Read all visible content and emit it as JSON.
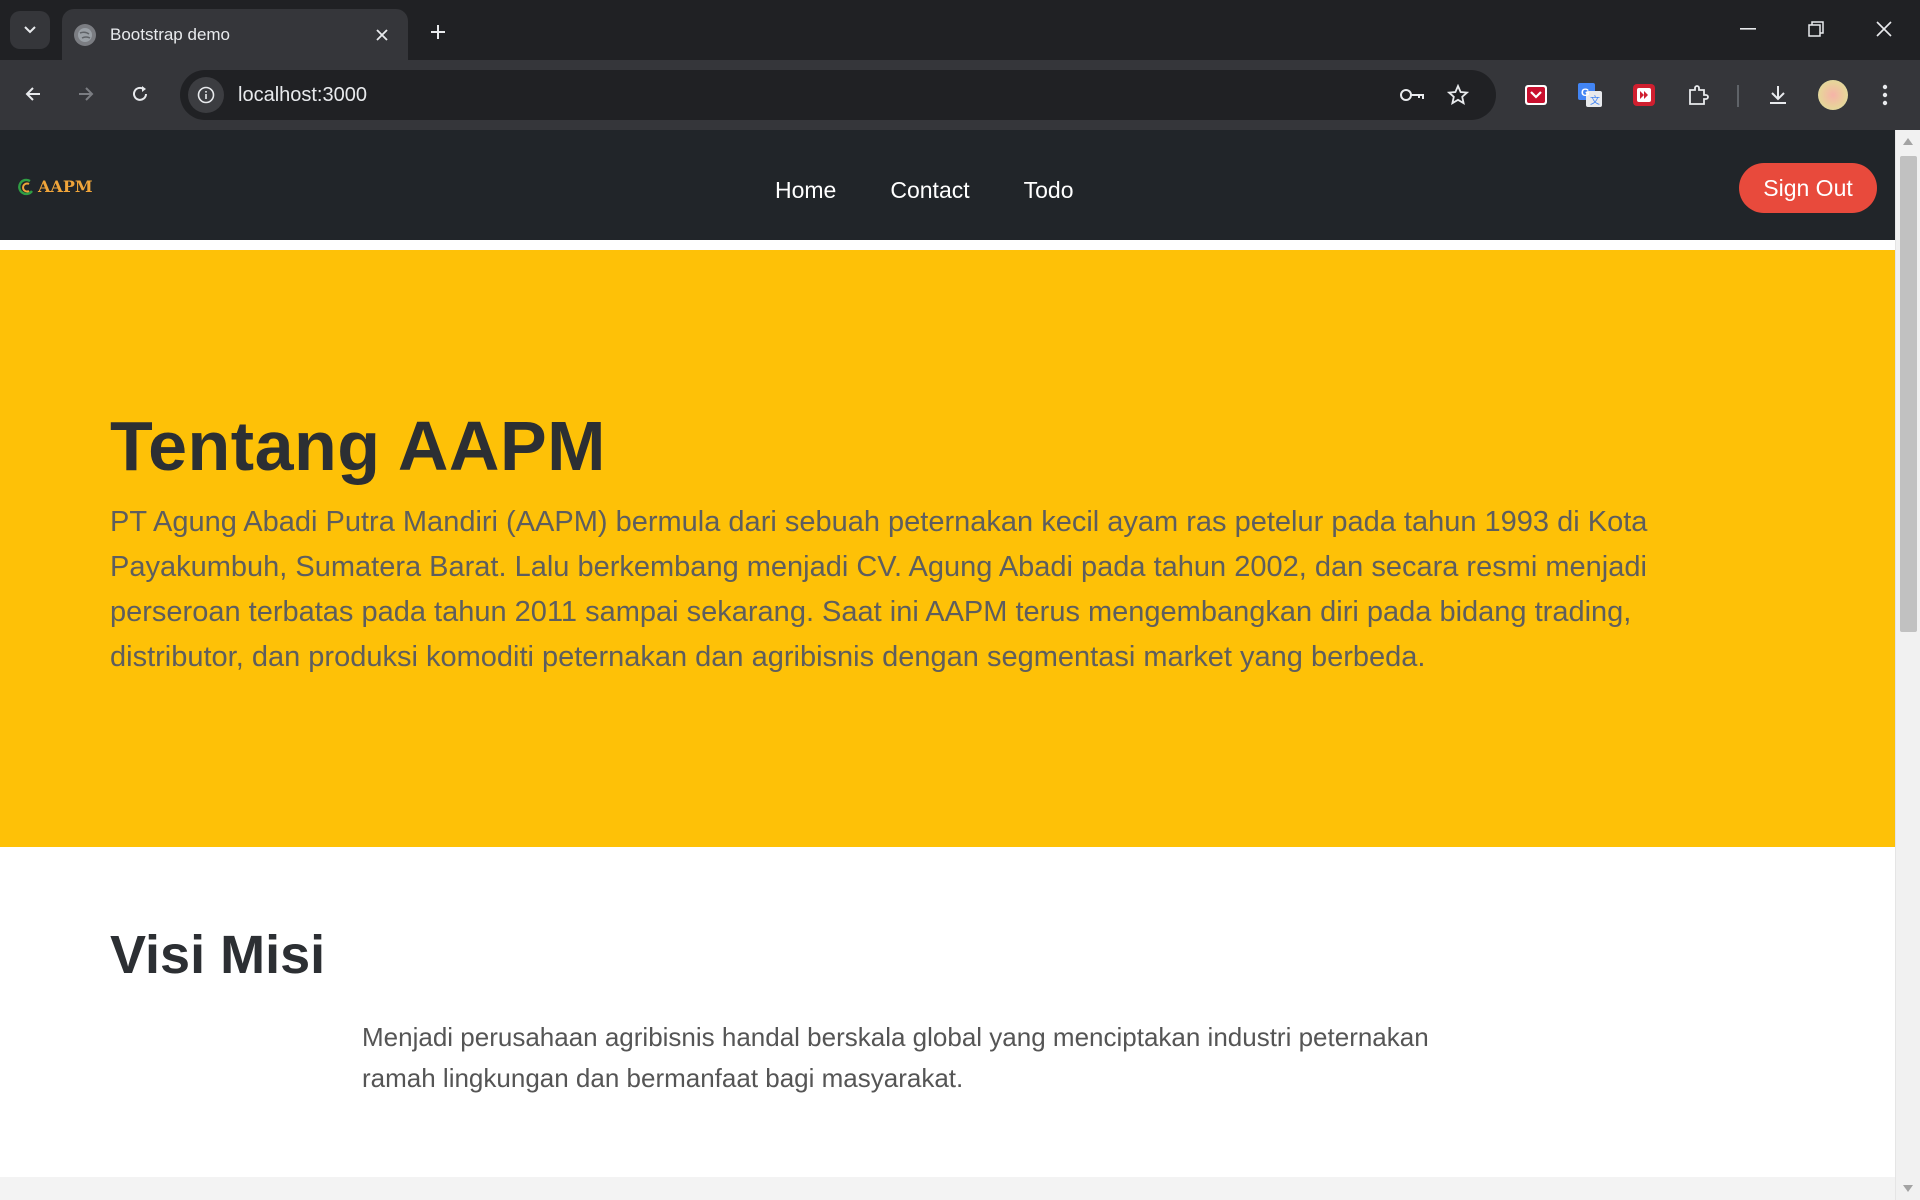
{
  "browser": {
    "tab_title": "Bootstrap demo",
    "url": "localhost:3000",
    "icons": [
      "tab-search-icon",
      "globe-icon",
      "close-icon",
      "plus-icon",
      "minimize-icon",
      "restore-icon",
      "window-close-icon",
      "back-icon",
      "forward-icon",
      "reload-icon",
      "site-info-icon",
      "key-icon",
      "star-icon",
      "pocket-extension-icon",
      "translate-extension-icon",
      "video-extension-icon",
      "puzzle-icon",
      "download-icon",
      "kebab-menu-icon"
    ]
  },
  "site": {
    "brand": "AAPM",
    "nav": [
      "Home",
      "Contact",
      "Todo"
    ],
    "sign_out": "Sign Out",
    "colors": {
      "nav_bg": "#212529",
      "hero_bg": "#fec107",
      "sign_out_bg": "#e84a3c",
      "brand": "#f0a53a"
    }
  },
  "hero": {
    "title": "Tentang AAPM",
    "text": "PT Agung Abadi Putra Mandiri (AAPM) bermula dari sebuah peternakan kecil ayam ras petelur pada tahun 1993 di Kota Payakumbuh, Sumatera Barat. Lalu berkembang menjadi CV. Agung Abadi pada tahun 2002, dan secara resmi menjadi perseroan terbatas pada tahun 2011 sampai sekarang. Saat ini AAPM terus mengembangkan diri pada bidang trading, distributor, dan produksi komoditi peternakan dan agribisnis dengan segmentasi market yang berbeda."
  },
  "visi_misi": {
    "title": "Visi Misi",
    "text": "Menjadi perusahaan agribisnis handal berskala global yang menciptakan industri peternakan ramah lingkungan dan bermanfaat bagi masyarakat."
  }
}
